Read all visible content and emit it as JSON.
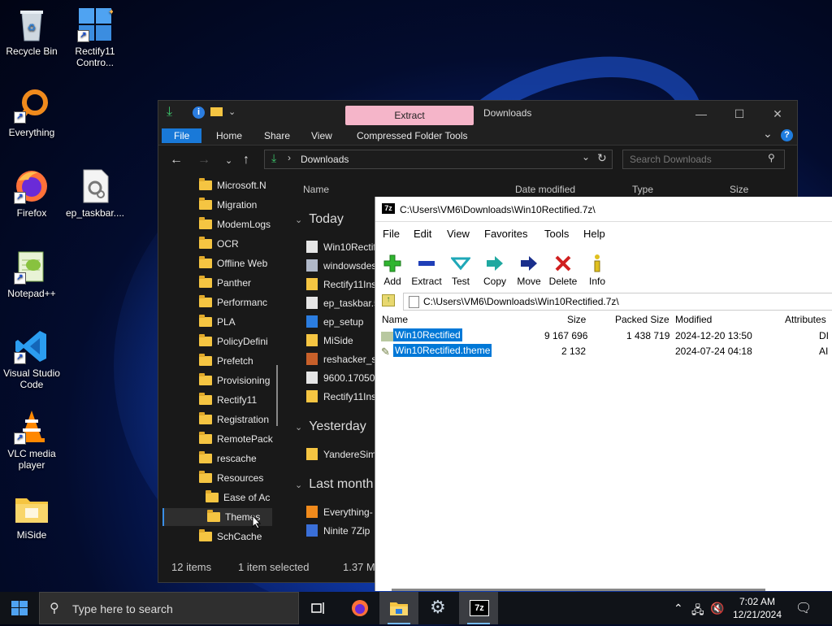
{
  "desktop": {
    "icons": [
      {
        "label": "Recycle Bin"
      },
      {
        "label": "Rectify11 Contro..."
      },
      {
        "label": "Everything"
      },
      {
        "label": "Firefox"
      },
      {
        "label": "ep_taskbar...."
      },
      {
        "label": "Notepad++"
      },
      {
        "label": "Visual Studio Code"
      },
      {
        "label": "VLC media player"
      },
      {
        "label": "MiSide"
      }
    ]
  },
  "explorer": {
    "context_tab": "Extract",
    "title": "Downloads",
    "ribbon_tabs": [
      "File",
      "Home",
      "Share",
      "View",
      "Compressed Folder Tools"
    ],
    "breadcrumb": "Downloads",
    "search_placeholder": "Search Downloads",
    "columns": [
      "Name",
      "Date modified",
      "Type",
      "Size"
    ],
    "nav_items": [
      "Microsoft.N",
      "Migration",
      "ModemLogs",
      "OCR",
      "Offline Web",
      "Panther",
      "Performanc",
      "PLA",
      "PolicyDefini",
      "Prefetch",
      "Provisioning",
      "Rectify11",
      "Registration",
      "RemotePack",
      "rescache",
      "Resources",
      "Ease of Ac",
      "Themes",
      "SchCache"
    ],
    "groups": {
      "today": "Today",
      "yesterday": "Yesterday",
      "last_month": "Last month"
    },
    "today_files": [
      "Win10Rectif",
      "windowsdes",
      "Rectify11Ins",
      "ep_taskbar.5",
      "ep_setup",
      "MiSide",
      "reshacker_se",
      "9600.17050.\\",
      "Rectify11Ins"
    ],
    "yesterday_files": [
      "YandereSim"
    ],
    "last_month_files": [
      "Everything-",
      "Ninite 7Zip"
    ],
    "status": {
      "items": "12 items",
      "selected": "1 item selected",
      "size": "1.37 MB"
    }
  },
  "sevenzip": {
    "title": "C:\\Users\\VM6\\Downloads\\Win10Rectified.7z\\",
    "menu": [
      "File",
      "Edit",
      "View",
      "Favorites",
      "Tools",
      "Help"
    ],
    "toolbar": [
      "Add",
      "Extract",
      "Test",
      "Copy",
      "Move",
      "Delete",
      "Info"
    ],
    "address": "C:\\Users\\VM6\\Downloads\\Win10Rectified.7z\\",
    "columns": [
      "Name",
      "Size",
      "Packed Size",
      "Modified",
      "Attributes"
    ],
    "rows": [
      {
        "name": "Win10Rectified",
        "size": "9 167 696",
        "packed": "1 438 719",
        "modified": "2024-12-20 13:50",
        "attr": "DI"
      },
      {
        "name": "Win10Rectified.theme",
        "size": "2 132",
        "packed": "",
        "modified": "2024-07-24 04:18",
        "attr": "AI"
      }
    ]
  },
  "taskbar": {
    "search_placeholder": "Type here to search",
    "time": "7:02 AM",
    "date": "12/21/2024",
    "colors": {
      "accent": "#0078d7",
      "extract_tab": "#f5b5c9"
    }
  }
}
